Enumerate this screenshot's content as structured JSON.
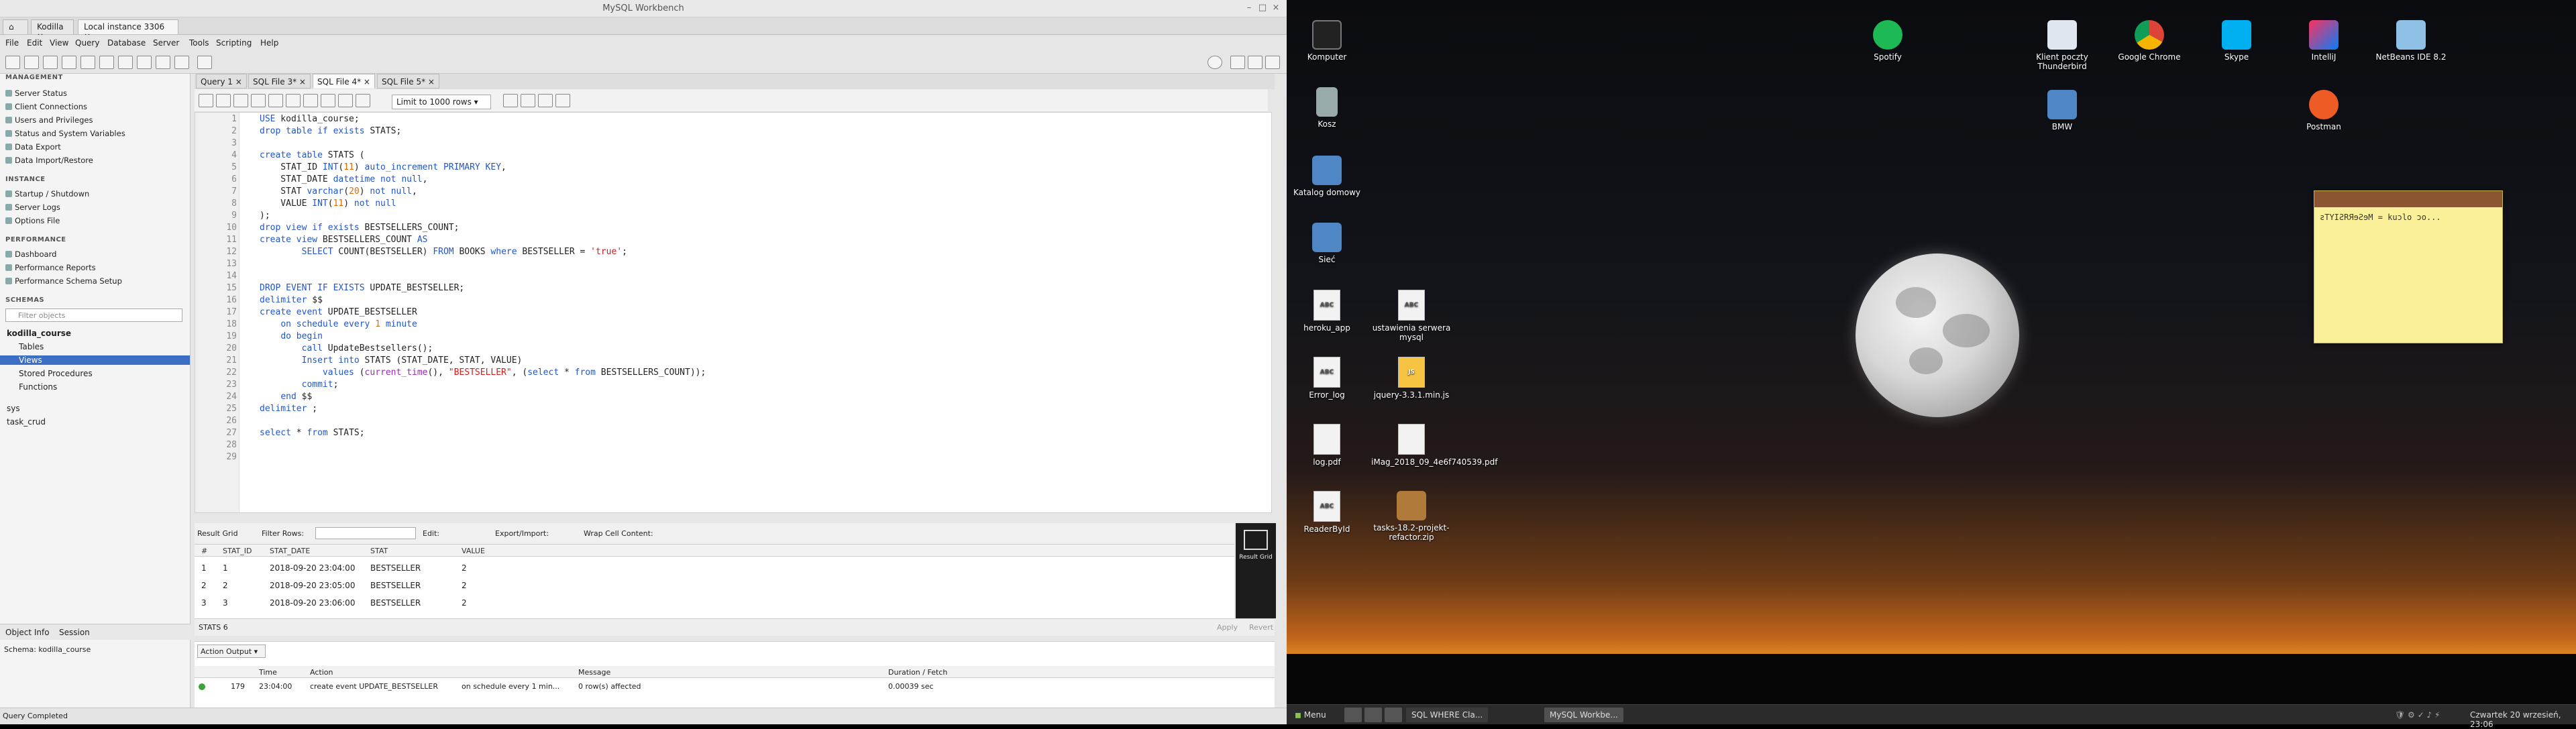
{
  "window": {
    "title": "MySQL Workbench",
    "min": "–",
    "max": "□",
    "close": "×"
  },
  "conn_tabs": [
    {
      "label": "Kodilla"
    },
    {
      "label": "Local instance 3306"
    }
  ],
  "menus": [
    "File",
    "Edit",
    "View",
    "Query",
    "Database",
    "Server",
    "Tools",
    "Scripting",
    "Help"
  ],
  "sidebar": {
    "management_header": "MANAGEMENT",
    "management": [
      "Server Status",
      "Client Connections",
      "Users and Privileges",
      "Status and System Variables",
      "Data Export",
      "Data Import/Restore"
    ],
    "instance_header": "INSTANCE",
    "instance": [
      "Startup / Shutdown",
      "Server Logs",
      "Options File"
    ],
    "performance_header": "PERFORMANCE",
    "performance": [
      "Dashboard",
      "Performance Reports",
      "Performance Schema Setup"
    ],
    "schemas_header": "SCHEMAS",
    "filter_placeholder": "Filter objects",
    "tree": {
      "db": "kodilla_course",
      "tables": "Tables",
      "views": "Views",
      "procs": "Stored Procedures",
      "funcs": "Functions",
      "sys": "sys",
      "task": "task_crud"
    },
    "info_tabs": [
      "Object Info",
      "Session"
    ],
    "schema_info": "Schema: kodilla_course"
  },
  "query_tabs": [
    "Query 1",
    "SQL File 3*",
    "SQL File 4*",
    "SQL File 5*"
  ],
  "limit": "Limit to 1000 rows",
  "results": {
    "bar": {
      "result_grid": "Result Grid",
      "filter_rows": "Filter Rows:",
      "edit": "Edit:",
      "export": "Export/Import:",
      "wrap": "Wrap Cell Content:"
    },
    "side_label": "Result Grid",
    "columns": [
      "#",
      "STAT_ID",
      "STAT_DATE",
      "STAT",
      "VALUE"
    ],
    "rows": [
      [
        "1",
        "1",
        "2018-09-20 23:04:00",
        "BESTSELLER",
        "2"
      ],
      [
        "2",
        "2",
        "2018-09-20 23:05:00",
        "BESTSELLER",
        "2"
      ],
      [
        "3",
        "3",
        "2018-09-20 23:06:00",
        "BESTSELLER",
        "2"
      ]
    ],
    "tab": "STATS 6",
    "apply": "Apply",
    "revert": "Revert"
  },
  "output": {
    "selector": "Action Output",
    "columns": [
      "Time",
      "Action",
      "Message",
      "Duration / Fetch"
    ],
    "row": {
      "num": "179",
      "time": "23:04:00",
      "action": "create event UPDATE_BESTSELLER",
      "schedule": "on schedule every 1 min...",
      "message": "0 row(s) affected",
      "duration": "0.00039 sec"
    }
  },
  "status": "Query Completed",
  "desktop": {
    "icons": [
      "Komputer",
      "Kosz",
      "Katalog domowy",
      "Sieć",
      "heroku_app",
      "ustawienia serwera mysql",
      "Error_log",
      "jquery-3.3.1.min.js",
      "log.pdf",
      "iMag_2018_09_4e6f740539.pdf",
      "ReaderById",
      "tasks-18.2-projekt-refactor.zip",
      "Spotify",
      "Klient poczty Thunderbird",
      "Google Chrome",
      "Skype",
      "IntelliJ",
      "NetBeans IDE 8.2",
      "BMW",
      "Postman"
    ],
    "note_text": "ƨTYIƧRЯɘƧɘM = kuɔlo ɔo...",
    "taskbar": {
      "menu": "Menu",
      "task1": "SQL WHERE Cla...",
      "task2": "MySQL Workbe...",
      "clock": "Czwartek 20 wrzesień, 23:06"
    }
  },
  "colors": {
    "selection": "#3c6fc3",
    "keyword": "#2256c9",
    "number": "#e06a00",
    "string": "#d41b1b"
  }
}
